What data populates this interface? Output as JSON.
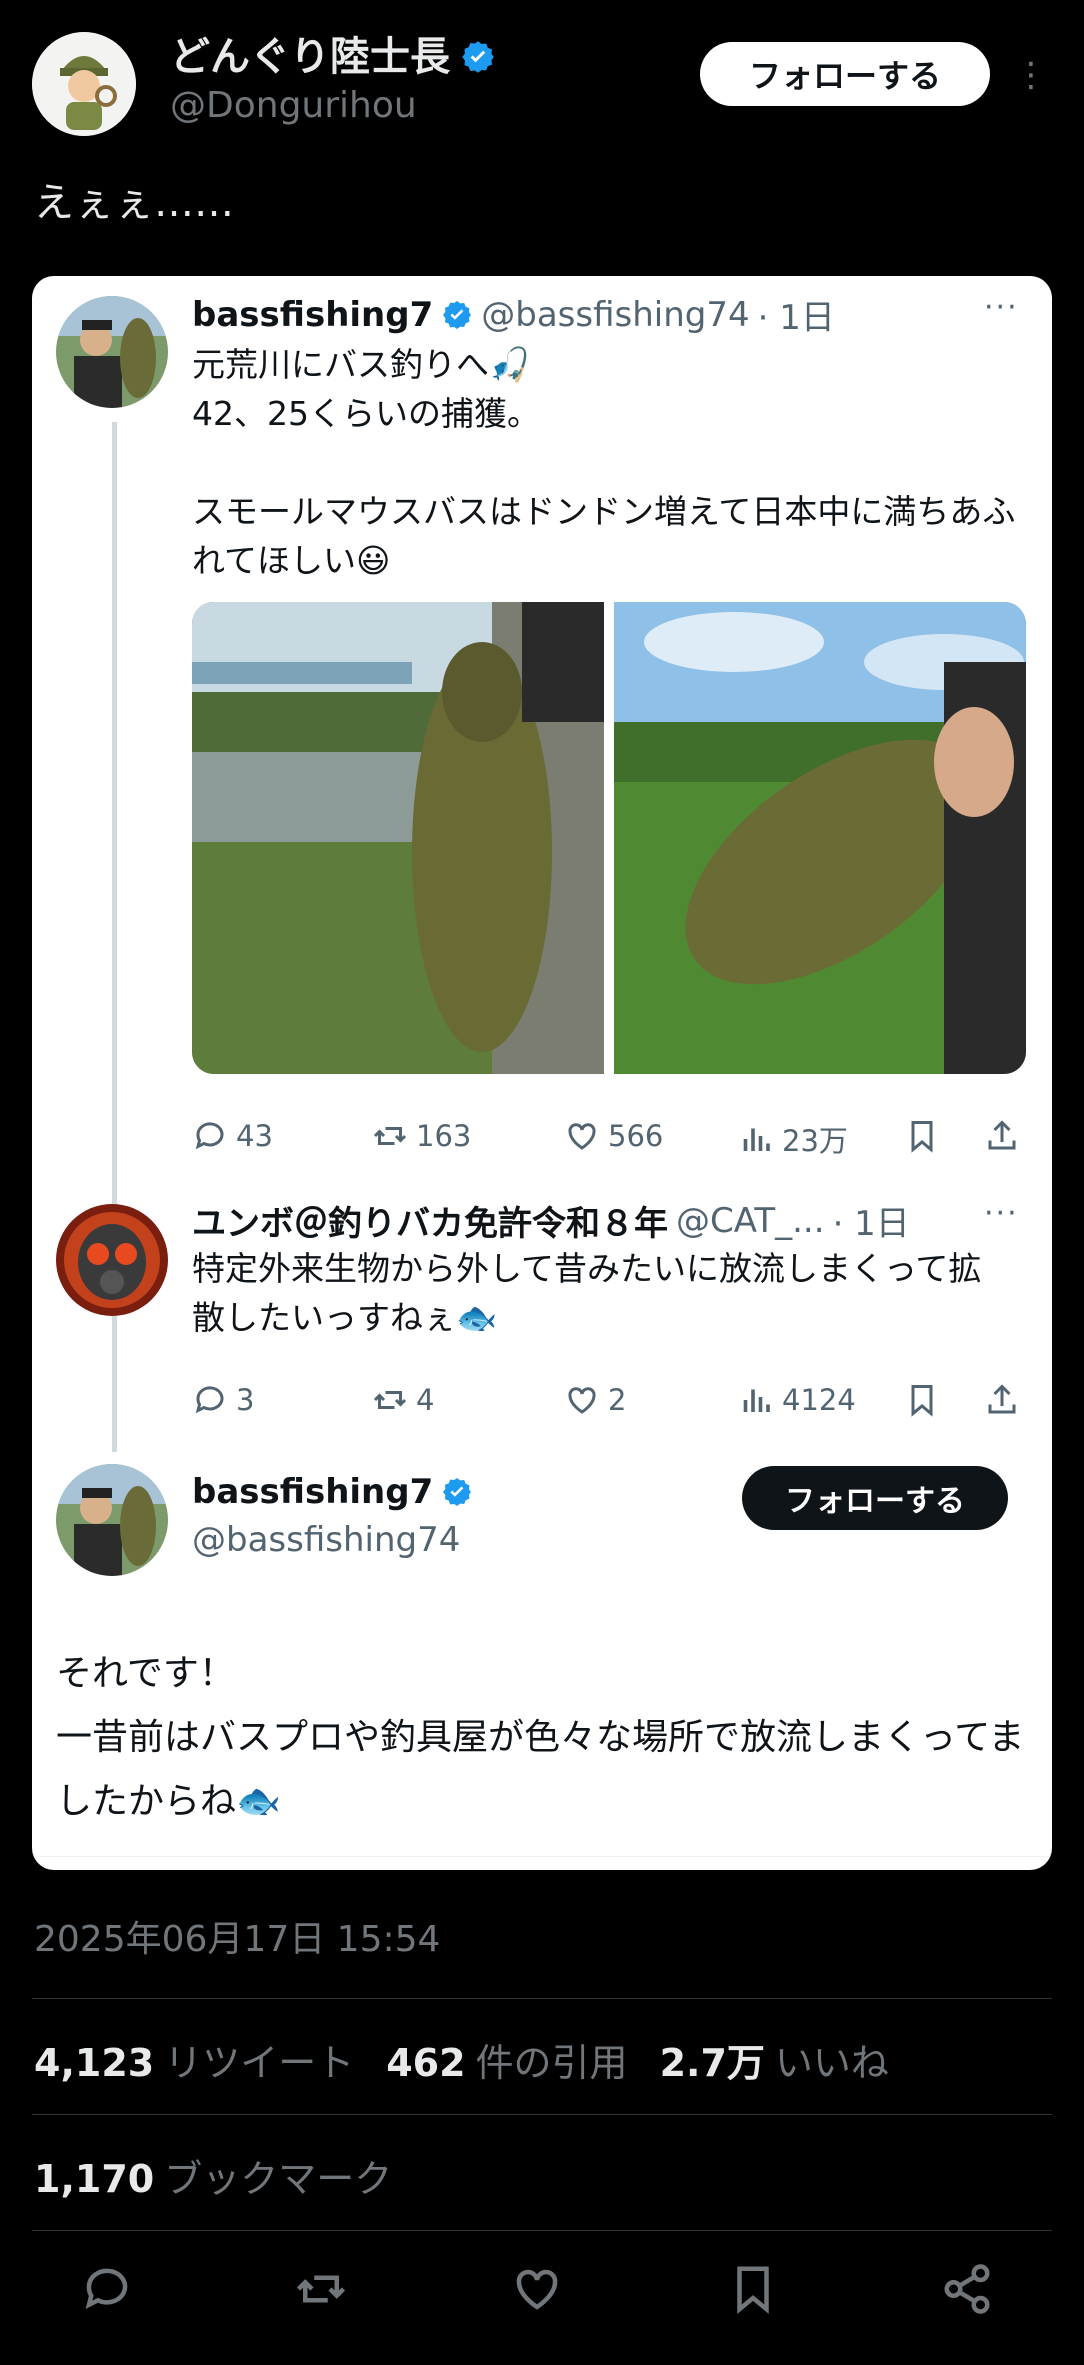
{
  "header": {
    "display_name": "どんぐり陸士長",
    "handle": "@Dongurihou",
    "follow_label": "フォローする"
  },
  "tweet": {
    "text": "えぇぇ……"
  },
  "quoted_thread": {
    "post1": {
      "name": "bassfishing7",
      "handle": "@bassfishing74",
      "time": "· 1日",
      "text": "元荒川にバス釣りへ🎣\n42、25くらいの捕獲。\n\nスモールマウスバスはドンドン増えて日本中に満ちあふれてほしい😃",
      "replies": "43",
      "retweets": "163",
      "likes": "566",
      "views": "23万"
    },
    "post2": {
      "name": "ユンボ＠釣りバカ免許令和８年",
      "handle": "@CAT_...",
      "time": "· 1日",
      "text": "特定外来生物から外して昔みたいに放流しまくって拡散したいっすねぇ🐟",
      "replies": "3",
      "retweets": "4",
      "likes": "2",
      "views": "4124"
    },
    "post3": {
      "name": "bassfishing7",
      "handle": "@bassfishing74",
      "follow_label": "フォローする",
      "text": "それです！\n一昔前はバスプロや釣具屋が色々な場所で放流しまくってましたからね🐟"
    }
  },
  "meta": {
    "timestamp": "2025年06月17日 15:54",
    "retweets_count": "4,123",
    "retweets_label": "リツイート",
    "quotes_count": "462",
    "quotes_label": "件の引用",
    "likes_count": "2.7万",
    "likes_label": "いいね",
    "bookmarks_count": "1,170",
    "bookmarks_label": "ブックマーク"
  },
  "colors": {
    "verified": "#1d9bf0",
    "background": "#000000",
    "card": "#ffffff"
  },
  "icons": [
    "verified-badge-icon",
    "more-icon",
    "reply-icon",
    "retweet-icon",
    "like-icon",
    "views-icon",
    "bookmark-icon",
    "share-icon"
  ]
}
